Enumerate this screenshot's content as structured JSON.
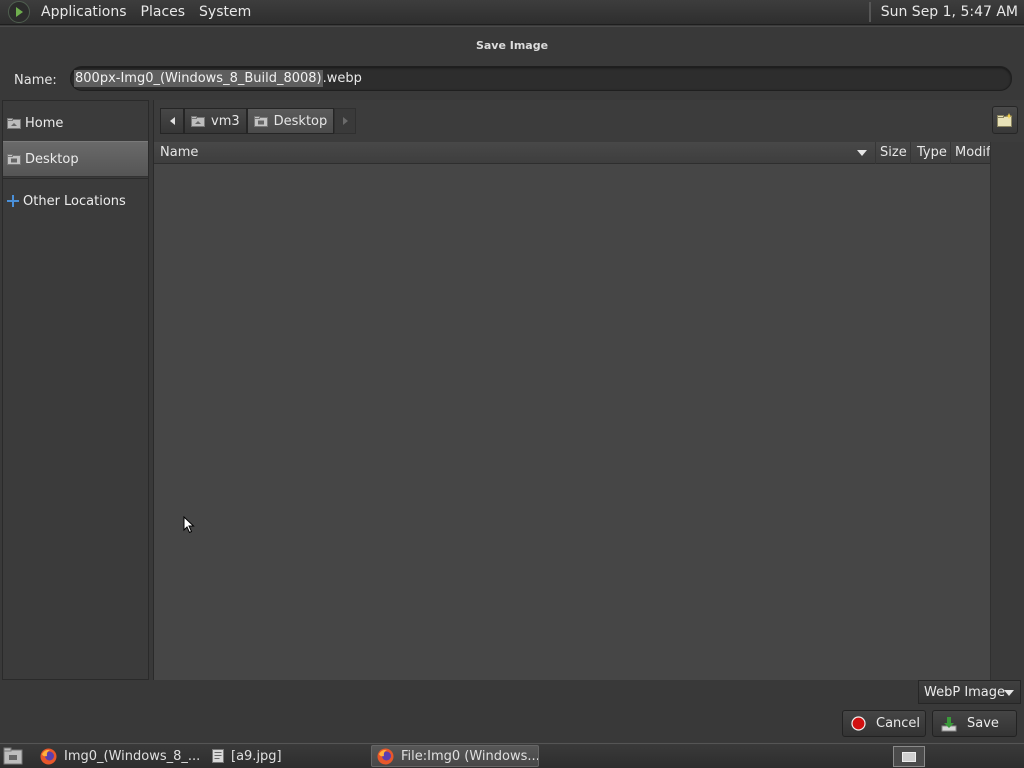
{
  "top_panel": {
    "menus": [
      "Applications",
      "Places",
      "System"
    ],
    "clock": "Sun Sep  1,  5:47 AM"
  },
  "dialog": {
    "title": "Save Image",
    "name_label": "Name:",
    "name_value": "800px-Img0_(Windows_8_Build_8008).webp",
    "name_selected_part": "800px-Img0_(Windows_8_Build_8008)",
    "name_unselected_part": ".webp",
    "sidebar": {
      "items": [
        {
          "label": "Home",
          "icon": "folder-home-icon",
          "selected": false
        },
        {
          "label": "Desktop",
          "icon": "folder-desktop-icon",
          "selected": true
        },
        {
          "label": "Other Locations",
          "icon": "plus-icon",
          "selected": false
        }
      ]
    },
    "pathbar": {
      "segments": [
        "vm3",
        "Desktop"
      ],
      "active": "Desktop"
    },
    "columns": {
      "name": "Name",
      "size": "Size",
      "type": "Type",
      "modified": "Modif"
    },
    "file_type_filter": "WebP Image",
    "buttons": {
      "cancel": "Cancel",
      "save": "Save"
    }
  },
  "taskbar": {
    "tasks": [
      {
        "label": "Img0_(Windows_8_...",
        "icon": "firefox-icon",
        "active": false
      },
      {
        "label": "[a9.jpg]",
        "icon": "image-viewer-icon",
        "active": false
      },
      {
        "label": "File:Img0 (Windows...",
        "icon": "firefox-icon",
        "active": true
      }
    ]
  },
  "colors": {
    "background": "#3a3a3a",
    "selection": "#5e5e5e",
    "cancel_icon": "#d01010",
    "save_icon": "#3a9a3a",
    "accent_blue": "#4a90d9"
  }
}
